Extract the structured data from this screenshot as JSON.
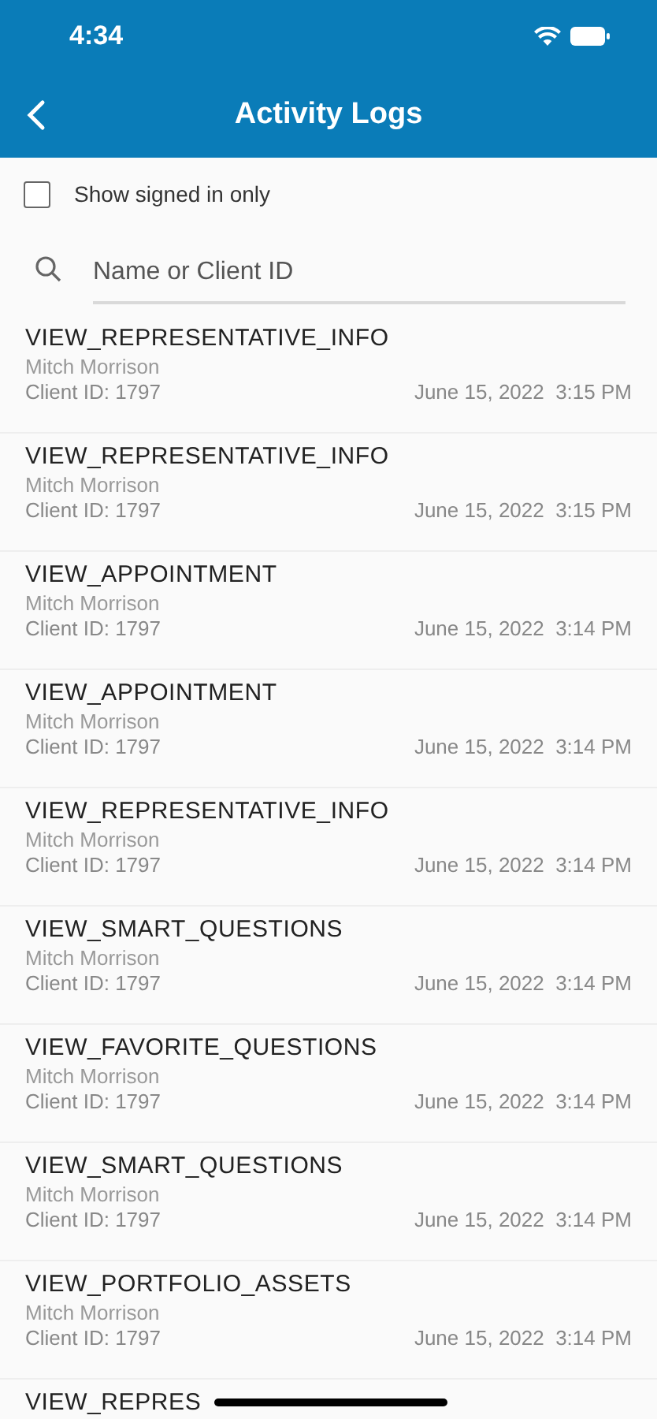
{
  "status_bar": {
    "time": "4:34"
  },
  "nav": {
    "title": "Activity Logs"
  },
  "filter": {
    "label": "Show signed in only",
    "checked": false
  },
  "search": {
    "placeholder": "Name or Client ID"
  },
  "logs": [
    {
      "action": "VIEW_REPRESENTATIVE_INFO",
      "name": "Mitch Morrison",
      "client": "Client ID: 1797",
      "timestamp": "June 15, 2022  3:15 PM"
    },
    {
      "action": "VIEW_REPRESENTATIVE_INFO",
      "name": "Mitch Morrison",
      "client": "Client ID: 1797",
      "timestamp": "June 15, 2022  3:15 PM"
    },
    {
      "action": "VIEW_APPOINTMENT",
      "name": "Mitch Morrison",
      "client": "Client ID: 1797",
      "timestamp": "June 15, 2022  3:14 PM"
    },
    {
      "action": "VIEW_APPOINTMENT",
      "name": "Mitch Morrison",
      "client": "Client ID: 1797",
      "timestamp": "June 15, 2022  3:14 PM"
    },
    {
      "action": "VIEW_REPRESENTATIVE_INFO",
      "name": "Mitch Morrison",
      "client": "Client ID: 1797",
      "timestamp": "June 15, 2022  3:14 PM"
    },
    {
      "action": "VIEW_SMART_QUESTIONS",
      "name": "Mitch Morrison",
      "client": "Client ID: 1797",
      "timestamp": "June 15, 2022  3:14 PM"
    },
    {
      "action": "VIEW_FAVORITE_QUESTIONS",
      "name": "Mitch Morrison",
      "client": "Client ID: 1797",
      "timestamp": "June 15, 2022  3:14 PM"
    },
    {
      "action": "VIEW_SMART_QUESTIONS",
      "name": "Mitch Morrison",
      "client": "Client ID: 1797",
      "timestamp": "June 15, 2022  3:14 PM"
    },
    {
      "action": "VIEW_PORTFOLIO_ASSETS",
      "name": "Mitch Morrison",
      "client": "Client ID: 1797",
      "timestamp": "June 15, 2022  3:14 PM"
    },
    {
      "action": "VIEW_REPRES"
    }
  ]
}
